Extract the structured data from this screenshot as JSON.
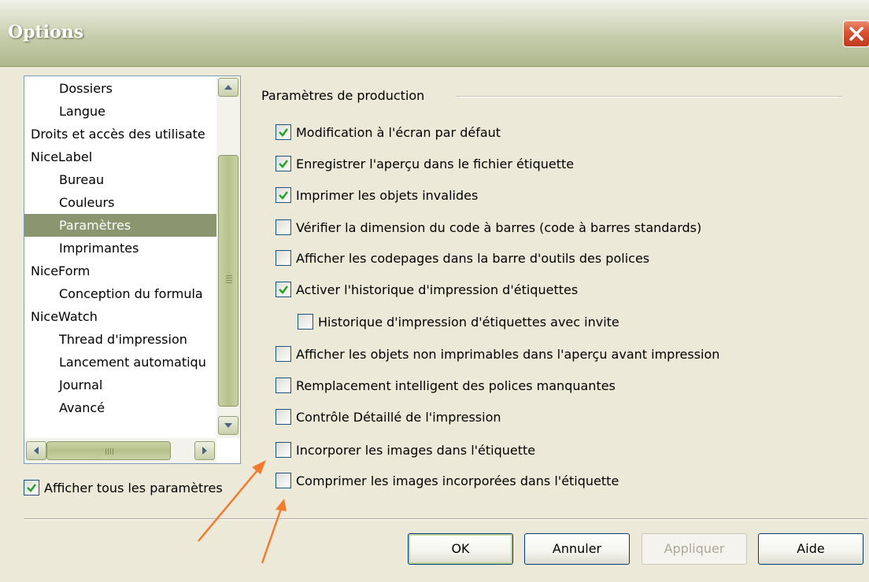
{
  "window": {
    "title": "Options"
  },
  "tree": {
    "items": [
      {
        "label": "Dossiers",
        "level": 1
      },
      {
        "label": "Langue",
        "level": 1
      },
      {
        "label": "Droits et accès des utilisate",
        "level": 0
      },
      {
        "label": "NiceLabel",
        "level": 0
      },
      {
        "label": "Bureau",
        "level": 1
      },
      {
        "label": "Couleurs",
        "level": 1
      },
      {
        "label": "Paramètres",
        "level": 1,
        "selected": true
      },
      {
        "label": "Imprimantes",
        "level": 1
      },
      {
        "label": "NiceForm",
        "level": 0
      },
      {
        "label": "Conception du formula",
        "level": 1
      },
      {
        "label": "NiceWatch",
        "level": 0
      },
      {
        "label": "Thread d'impression",
        "level": 1
      },
      {
        "label": "Lancement automatiqu",
        "level": 1
      },
      {
        "label": "Journal",
        "level": 1
      },
      {
        "label": "Avancé",
        "level": 1
      }
    ]
  },
  "show_all": {
    "label": "Afficher tous les paramètres",
    "checked": true
  },
  "group": {
    "title": "Paramètres de production",
    "options": [
      {
        "label": "Modification à l'écran par défaut",
        "checked": true
      },
      {
        "label": "Enregistrer l'aperçu dans le fichier étiquette",
        "checked": true
      },
      {
        "label": "Imprimer les objets invalides",
        "checked": true
      },
      {
        "label": "Vérifier la dimension du code à barres (code à barres standards)",
        "checked": false
      },
      {
        "label": "Afficher les codepages dans la barre d'outils des polices",
        "checked": false
      },
      {
        "label": "Activer l'historique d'impression d'étiquettes",
        "checked": true
      },
      {
        "label": "Historique d'impression d'étiquettes avec invite",
        "checked": false
      },
      {
        "label": "Afficher les objets non imprimables dans l'aperçu avant impression",
        "checked": false
      },
      {
        "label": "Remplacement intelligent des polices manquantes",
        "checked": false
      },
      {
        "label": "Contrôle Détaillé de l'impression",
        "checked": false
      },
      {
        "label": "Incorporer les images dans l'étiquette",
        "checked": false
      },
      {
        "label": "Comprimer les images incorporées dans l'étiquette",
        "checked": false
      }
    ]
  },
  "buttons": {
    "ok": "OK",
    "cancel": "Annuler",
    "apply": "Appliquer",
    "help": "Aide"
  },
  "icons": {
    "close": "close-icon",
    "scroll_up": "chevron-up-icon",
    "scroll_down": "chevron-down-icon",
    "scroll_left": "chevron-left-icon",
    "scroll_right": "chevron-right-icon",
    "check": "check-icon"
  },
  "colors": {
    "title_gradient_top": "#e6e8d8",
    "title_gradient_bottom": "#aeb78c",
    "selection": "#8b9570",
    "close_button": "#d65232",
    "checkmark": "#21a121",
    "annotation_arrow": "#f47a30"
  }
}
